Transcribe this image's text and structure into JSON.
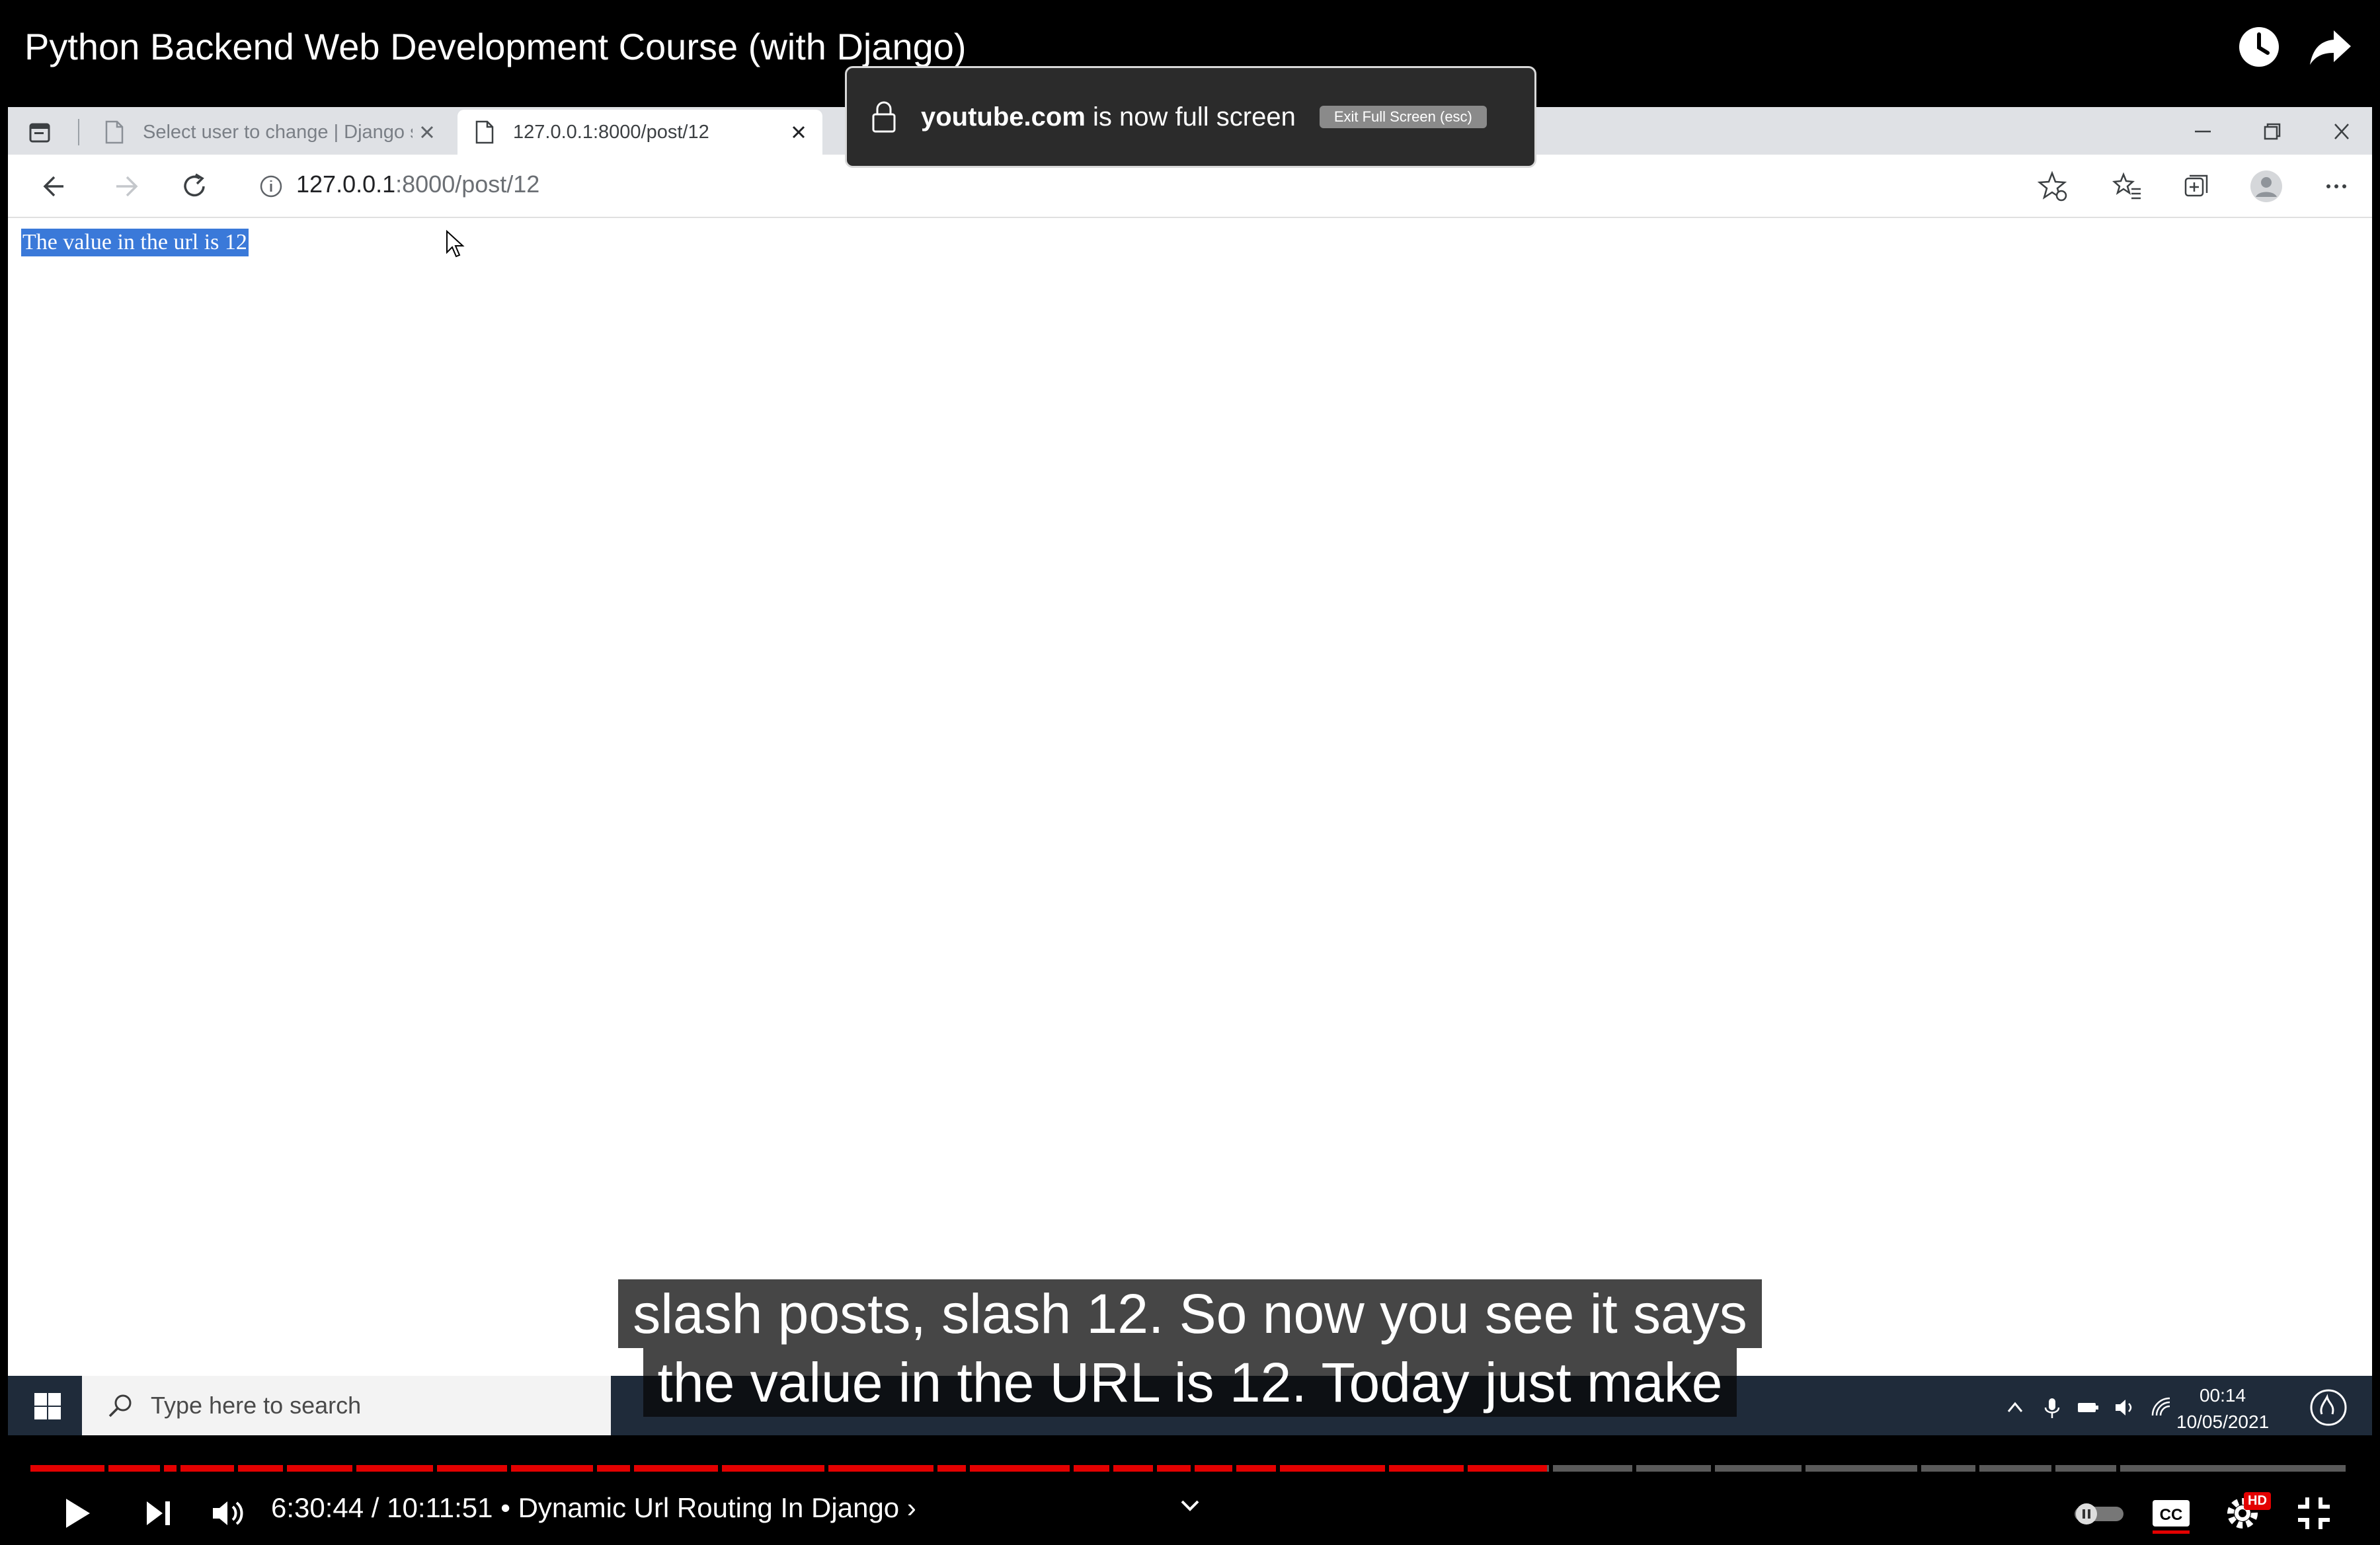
{
  "youtube": {
    "video_title": "Python Backend Web Development Course (with Django)",
    "icons": {
      "watch_later": "clock-icon",
      "share": "share-arrow-icon"
    },
    "fullscreen_notice": {
      "domain": "youtube.com",
      "message": " is now full screen",
      "exit_button": "Exit Full Screen (esc)"
    },
    "subtitles": [
      "slash posts, slash 12. So now you see it says",
      "the value in the URL is 12. Today just make"
    ],
    "player": {
      "current_time": "6:30:44",
      "separator": " / ",
      "duration": "10:11:51",
      "chapter_prefix": " • ",
      "chapter": "Dynamic Url Routing In Django",
      "chapter_arrow": " ›",
      "progress_fraction": 0.655,
      "hd_badge": "HD"
    }
  },
  "browser": {
    "tabs": [
      {
        "label": "Select user to change | Django s",
        "active": false
      },
      {
        "label": "127.0.0.1:8000/post/12",
        "active": true
      }
    ],
    "address": {
      "host": "127.0.0.1",
      "path": ":8000/post/12"
    },
    "page_content": "The value in the url is 12"
  },
  "taskbar": {
    "search_placeholder": "Type here to search",
    "time": "00:14",
    "date": "10/05/2021"
  },
  "colors": {
    "accent_red": "#e30000",
    "selection_blue": "#3a79d9"
  }
}
